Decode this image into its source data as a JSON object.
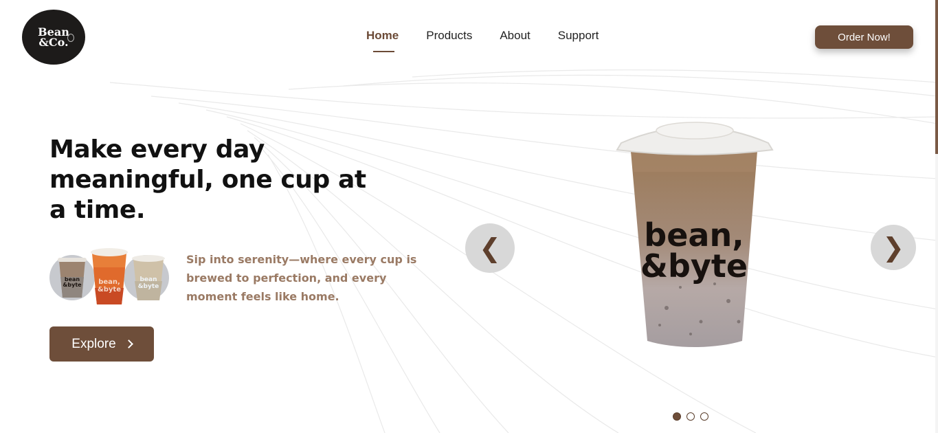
{
  "brand": {
    "logo_text": "Bean\n&Co."
  },
  "nav": {
    "items": [
      {
        "label": "Home",
        "active": true
      },
      {
        "label": "Products",
        "active": false
      },
      {
        "label": "About",
        "active": false
      },
      {
        "label": "Support",
        "active": false
      }
    ]
  },
  "header": {
    "order_label": "Order Now!"
  },
  "hero": {
    "headline": "Make every day meaningful, one cup at a time.",
    "tagline": "Sip into serenity—where every cup is brewed to perfection, and every moment feels like home.",
    "explore_label": "Explore",
    "cup_print": "bean\n&byte"
  },
  "carousel": {
    "prev_glyph": "❮",
    "next_glyph": "❯",
    "slide_count": 3,
    "active_index": 0
  },
  "icons": {
    "logo": "coffee-bean-logo",
    "explore": "chevron-right-icon",
    "prev": "chevron-left-icon",
    "next": "chevron-right-icon"
  },
  "colors": {
    "brand_brown": "#6e4e3a",
    "tagline_brown": "#9a7a64",
    "logo_bg": "#1d1b1a"
  }
}
